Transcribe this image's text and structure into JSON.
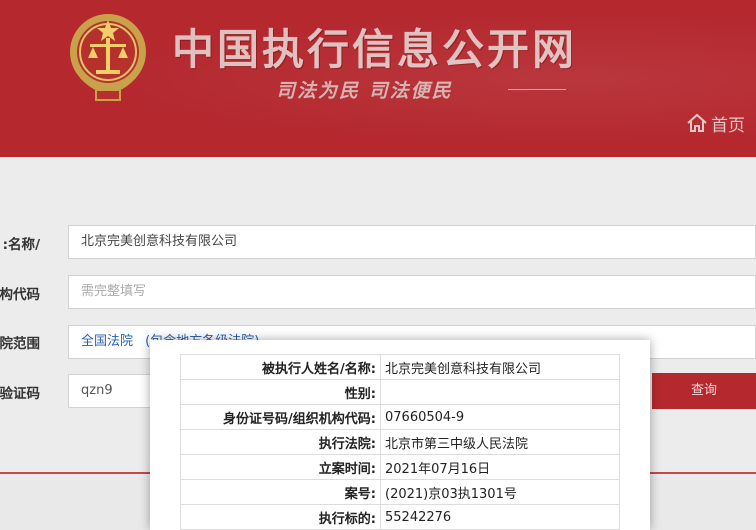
{
  "header": {
    "site_title": "中国执行信息公开网",
    "slogan": "司法为民  司法便民",
    "home_label": "首页",
    "brand_color": "#b4282e"
  },
  "form": {
    "name_label": "/名称:",
    "name_value": "北京完美创意科技有限公司",
    "code_label": "构代码:",
    "code_placeholder": "需完整填写",
    "court_label": "院范围:",
    "court_value": "全国法院",
    "court_hint": "(包含地方各级法院)",
    "captcha_label": "验证码:",
    "captcha_value": "qzn9",
    "query_button": "查询"
  },
  "result": {
    "rows": [
      {
        "key": "被执行人姓名/名称:",
        "value": "北京完美创意科技有限公司"
      },
      {
        "key": "性别:",
        "value": ""
      },
      {
        "key": "身份证号码/组织机构代码:",
        "value": "07660504-9"
      },
      {
        "key": "执行法院:",
        "value": "北京市第三中级人民法院"
      },
      {
        "key": "立案时间:",
        "value": "2021年07月16日"
      },
      {
        "key": "案号:",
        "value": "(2021)京03执1301号"
      },
      {
        "key": "执行标的:",
        "value": "55242276"
      }
    ]
  }
}
